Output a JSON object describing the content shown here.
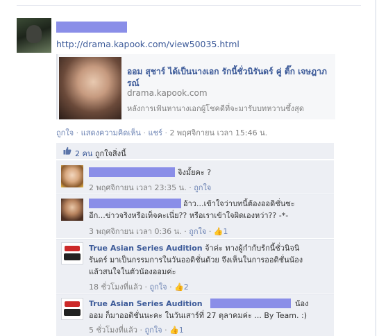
{
  "post": {
    "link_url": "http://drama.kapook.com/view50035.html",
    "share": {
      "title": "ออม สุชาร์ ได้เป็นนางเอก รักนี้ชั่วนิรันดร์ คู่ ติ๊ก เจษฎาภรณ์",
      "domain": "drama.kapook.com",
      "description": "หลังการเฟ้นหานางเอกผู้โชคดีที่จะมารับบทหวานซึ้งสุด"
    },
    "actions": {
      "like": "ถูกใจ",
      "comment": "แสดงความคิดเห็น",
      "share": "แชร์",
      "timestamp": "2 พฤศจิกายน เวลา 15:46 น.",
      "separator": "·"
    }
  },
  "likes": {
    "count_text": "2 คน",
    "label": "ถูกใจสิ่งนี้"
  },
  "comments": [
    {
      "name": "",
      "text_lines": [
        "จิงมั้ยคะ ?"
      ],
      "timestamp": "2 พฤศจิกายน เวลา 23:35 น.",
      "like_label": "ถูกใจ",
      "like_count": ""
    },
    {
      "name": "",
      "text_lines": [
        "อ้าว...เข้าใจว่าบทนี้ต้องออดิชั่นซะ",
        "อีก...ข่าวจริงหรือเท็จคะเนี่ย?? หรือเราเข้าใจผิดเองหว่า?? -*-"
      ],
      "timestamp": "3 พฤศจิกายน เวลา 0:36 น.",
      "like_label": "ถูกใจ",
      "like_count": "1"
    },
    {
      "name": "True Asian Series Audition",
      "text_lines": [
        "จ้าค่ะ ทางผู้กำกับรักนี้ชั่วนิจนิ",
        "รันดร์ มาเป็นกรรมการในวันออดิชั่นด้วย จึงเห็นในการออดิชั่นน้อง",
        "แล้วสนใจในตัวน้องออมค่ะ"
      ],
      "timestamp": "18 ชั่วโมงที่แล้ว",
      "like_label": "ถูกใจ",
      "like_count": "2"
    },
    {
      "name": "True Asian Series Audition",
      "text_lines": [
        "น้อง",
        "ออม ก็มาออดิชั่นนะคะ ในวันเสาร์ที่ 27 ตุลาคมค่ะ ... By Team. :)"
      ],
      "timestamp": "5 ชั่วโมงที่แล้ว",
      "like_label": "ถูกใจ",
      "like_count": "1"
    }
  ],
  "icons": {
    "like": "thumbs-up-icon",
    "logo": "true-asian-series-logo"
  },
  "colors": {
    "link_blue": "#3b5998",
    "muted_link": "#6d84b4",
    "meta_gray": "#808080",
    "panel_bg": "#edeff4",
    "redaction": "#8a8ee8"
  }
}
